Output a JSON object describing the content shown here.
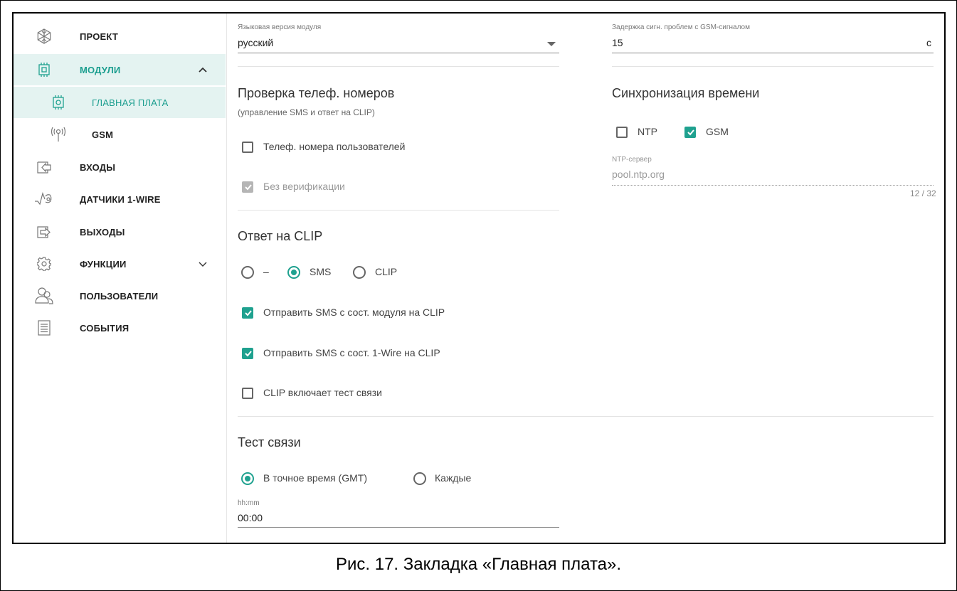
{
  "sidebar": {
    "items": [
      {
        "label": "ПРОЕКТ",
        "icon": "snowflake-icon"
      },
      {
        "label": "МОДУЛИ",
        "icon": "chip-icon"
      },
      {
        "label": "ГЛАВНАЯ ПЛАТА",
        "icon": "chip-icon"
      },
      {
        "label": "GSM",
        "icon": "antenna-icon"
      },
      {
        "label": "ВХОДЫ",
        "icon": "input-icon"
      },
      {
        "label": "ДАТЧИКИ 1-WIRE",
        "icon": "sensor-icon"
      },
      {
        "label": "ВЫХОДЫ",
        "icon": "output-icon"
      },
      {
        "label": "ФУНКЦИИ",
        "icon": "gear-icon"
      },
      {
        "label": "ПОЛЬЗОВАТЕЛИ",
        "icon": "users-icon"
      },
      {
        "label": "СОБЫТИЯ",
        "icon": "document-icon"
      }
    ]
  },
  "language": {
    "label": "Языковая версия модуля",
    "value": "русский"
  },
  "gsm_delay": {
    "label": "Задержка сигн. проблем с GSM-сигналом",
    "value": "15",
    "unit": "с"
  },
  "phone_check": {
    "title": "Проверка телеф. номеров",
    "subtitle": "(управление SMS и ответ на CLIP)",
    "user_numbers": {
      "label": "Телеф. номера пользователей",
      "checked": false
    },
    "no_verification": {
      "label": "Без верификации",
      "checked": true,
      "disabled": true
    }
  },
  "clip_answer": {
    "title": "Ответ на CLIP",
    "options": [
      "–",
      "SMS",
      "CLIP"
    ],
    "selected": "SMS",
    "send_module_state": {
      "label": "Отправить SMS с сост. модуля на CLIP",
      "checked": true
    },
    "send_1wire_state": {
      "label": "Отправить SMS с сост. 1-Wire на CLIP",
      "checked": true
    },
    "clip_test": {
      "label": "CLIP включает тест связи",
      "checked": false
    }
  },
  "link_test": {
    "title": "Тест связи",
    "options": [
      "В точное время (GMT)",
      "Каждые"
    ],
    "selected": "В точное время (GMT)",
    "time_label": "hh:mm",
    "time_value": "00:00"
  },
  "time_sync": {
    "title": "Синхронизация времени",
    "ntp": {
      "label": "NTP",
      "checked": false
    },
    "gsm": {
      "label": "GSM",
      "checked": true
    },
    "server_label": "NTP-сервер",
    "server_value": "pool.ntp.org",
    "counter": "12 / 32"
  },
  "caption": "Рис. 17. Закладка «Главная плата».",
  "colors": {
    "accent": "#1fa18f",
    "active_bg": "#e4f3f1"
  }
}
